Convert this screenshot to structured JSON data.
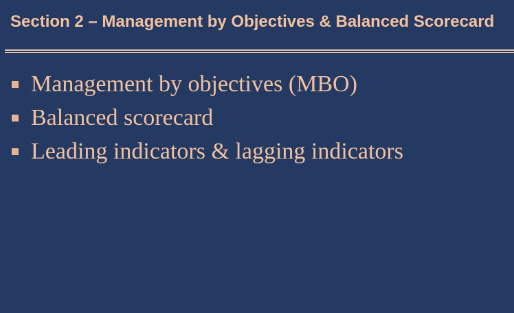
{
  "slide": {
    "title": "Section 2 – Management by Objectives & Balanced Scorecard",
    "bullets": [
      "Management by objectives (MBO)",
      "Balanced scorecard",
      "Leading indicators & lagging indicators"
    ]
  },
  "colors": {
    "background": "#243a63",
    "text_accent": "#f2c19f",
    "rule": "#e9c4a8",
    "bullet_marker": "#e7b492"
  },
  "icons": {
    "bullet": "square-bullet-icon"
  }
}
